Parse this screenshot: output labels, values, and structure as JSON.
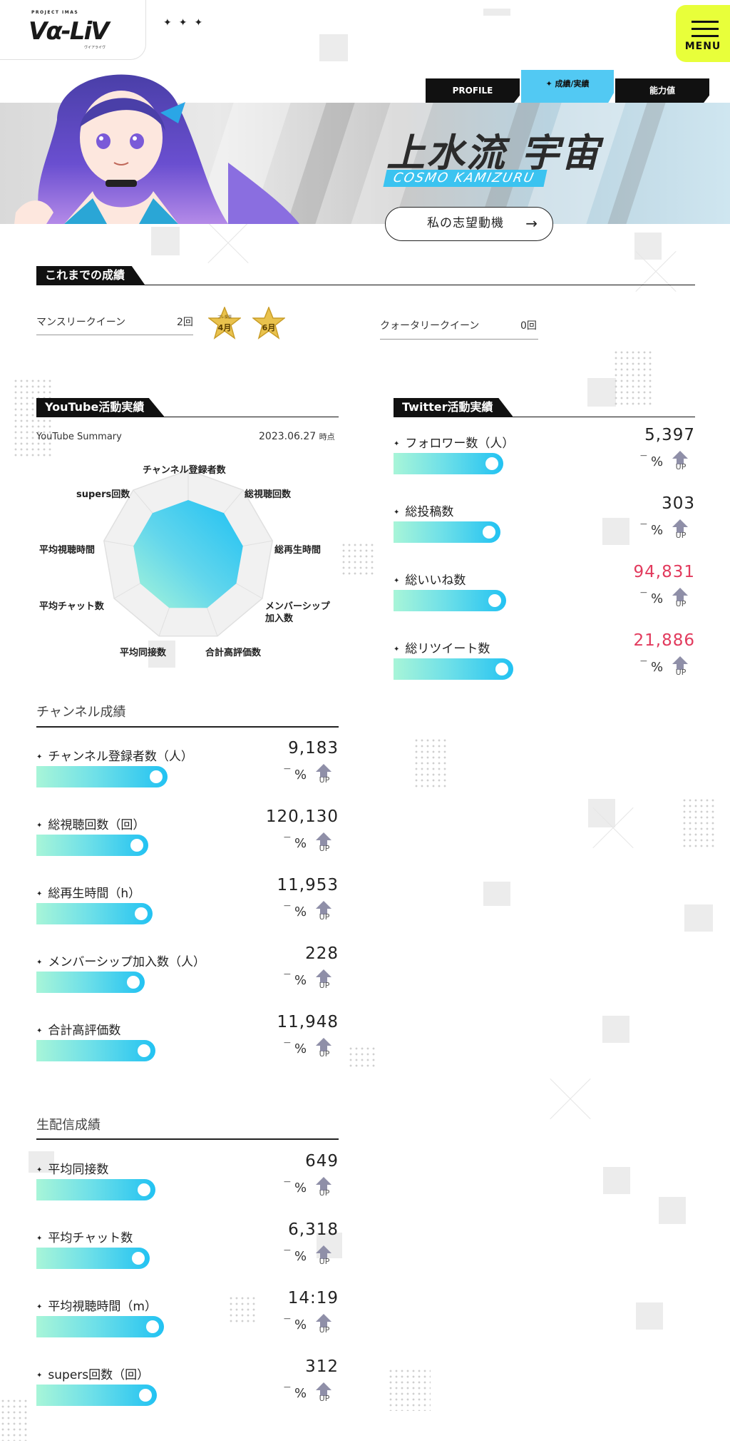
{
  "header": {
    "logo_sub": "PROJECT IMAS",
    "logo_main": "Vα-LiV",
    "logo_kana": "ヴイアライヴ",
    "stars": "✦✦✦",
    "menu_label": "MENU"
  },
  "tabs": [
    {
      "label": "PROFILE",
      "active": false
    },
    {
      "label": "✦ 成績/実績",
      "active": true
    },
    {
      "label": "能力値",
      "active": false
    }
  ],
  "profile": {
    "name_jp": "上水流 宇宙",
    "name_en": "COSMO KAMIZURU",
    "motive_button": "私の志望動機",
    "motive_arrow": "→"
  },
  "achievements": {
    "title": "これまでの成績",
    "monthly_label": "マンスリークイーン",
    "monthly_count": "2回",
    "badge_pre_label": "プレ投票",
    "badges": [
      "4月",
      "6月"
    ],
    "quarterly_label": "クォータリークイーン",
    "quarterly_count": "0回"
  },
  "youtube": {
    "title": "YouTube活動実績",
    "summary_label": "YouTube Summary",
    "summary_date": "2023.06.27",
    "summary_suffix": "時点",
    "radar_labels": [
      "チャンネル登録者数",
      "総視聴回数",
      "総再生時間",
      "メンバーシップ加入数",
      "合計高評価数",
      "平均同接数",
      "平均チャット数",
      "平均視聴時間",
      "supers回数"
    ],
    "channel_head": "チャンネル成績",
    "channel_stats": [
      {
        "name": "チャンネル登録者数（人）",
        "value": "9,183",
        "fill": 0.96
      },
      {
        "name": "総視聴回数（回）",
        "value": "120,130",
        "fill": 0.82
      },
      {
        "name": "総再生時間（h）",
        "value": "11,953",
        "fill": 0.85
      },
      {
        "name": "メンバーシップ加入数（人）",
        "value": "228",
        "fill": 0.79
      },
      {
        "name": "合計高評価数",
        "value": "11,948",
        "fill": 0.87
      }
    ],
    "live_head": "生配信成績",
    "live_stats": [
      {
        "name": "平均同接数",
        "value": "649",
        "fill": 0.87
      },
      {
        "name": "平均チャット数",
        "value": "6,318",
        "fill": 0.83
      },
      {
        "name": "平均視聴時間（m）",
        "value": "14:19",
        "fill": 0.93
      },
      {
        "name": "supers回数（回）",
        "value": "312",
        "fill": 0.88
      }
    ]
  },
  "twitter": {
    "title": "Twitter活動実績",
    "stats": [
      {
        "name": "フォロワー数（人）",
        "value": "5,397",
        "fill": 0.77,
        "pink": false
      },
      {
        "name": "総投稿数",
        "value": "303",
        "fill": 0.75,
        "pink": false
      },
      {
        "name": "総いいね数",
        "value": "94,831",
        "fill": 0.79,
        "pink": true
      },
      {
        "name": "総リツイート数",
        "value": "21,886",
        "fill": 0.84,
        "pink": true
      }
    ]
  },
  "stat_common": {
    "dash": "−",
    "pct": "%",
    "up": "UP"
  },
  "colors": {
    "accent": "#3bc3f0",
    "menu": "#e8ff3a",
    "pink": "#e23a5d"
  }
}
